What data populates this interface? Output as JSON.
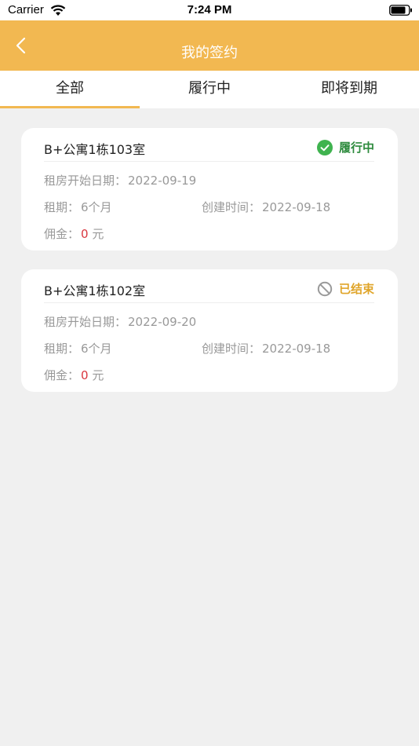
{
  "status_bar": {
    "carrier": "Carrier",
    "time": "7:24 PM"
  },
  "nav": {
    "title": "我的签约"
  },
  "tabs": [
    {
      "label": "全部",
      "active": true
    },
    {
      "label": "履行中",
      "active": false
    },
    {
      "label": "即将到期",
      "active": false
    }
  ],
  "colors": {
    "brand": "#f2b851",
    "active_status": "#2e8b3e",
    "ended_status": "#e0a52a",
    "fee": "#d9363e"
  },
  "contracts": [
    {
      "title": "B+公寓1栋103室",
      "status": "履行中",
      "status_icon": "check-circle-icon",
      "start_label": "租房开始日期：",
      "start_date": "2022-09-19",
      "lease_label": "租期：",
      "lease_value": "6个月",
      "created_label": "创建时间：",
      "created_date": "2022-09-18",
      "fee_label": "佣金：",
      "fee_value": "0",
      "fee_unit": "元"
    },
    {
      "title": "B+公寓1栋102室",
      "status": "已结束",
      "status_icon": "prohibited-icon",
      "start_label": "租房开始日期：",
      "start_date": "2022-09-20",
      "lease_label": "租期：",
      "lease_value": "6个月",
      "created_label": "创建时间：",
      "created_date": "2022-09-18",
      "fee_label": "佣金：",
      "fee_value": "0",
      "fee_unit": "元"
    }
  ]
}
